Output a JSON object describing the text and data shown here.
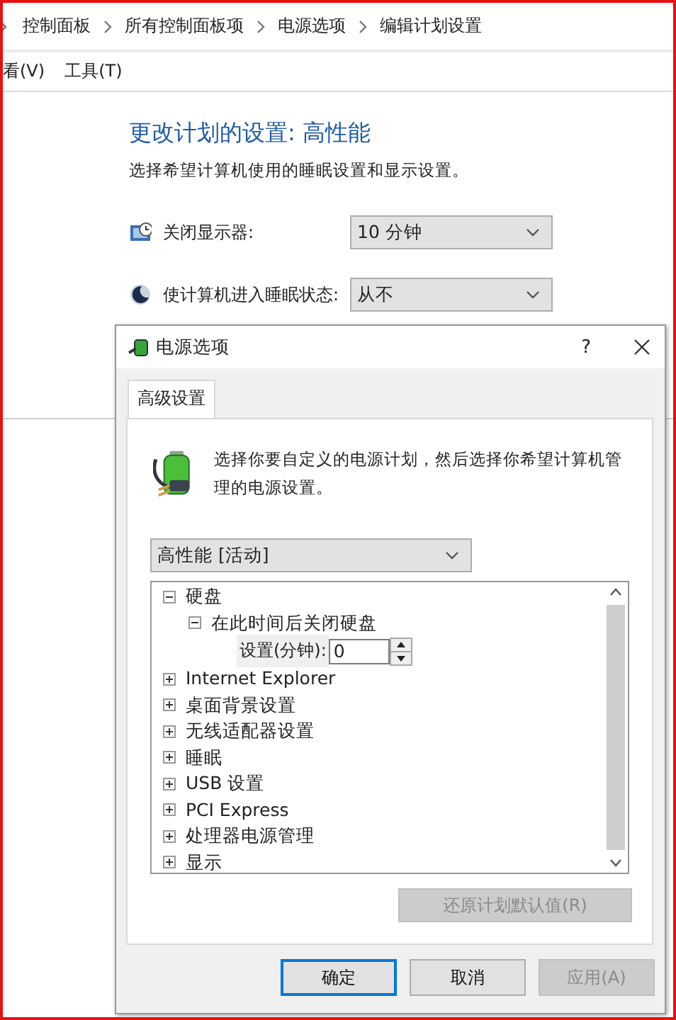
{
  "breadcrumb": [
    "控制面板",
    "所有控制面板项",
    "电源选项",
    "编辑计划设置"
  ],
  "menu": [
    "看(V)",
    "工具(T)"
  ],
  "page": {
    "title": "更改计划的设置: 高性能",
    "subtitle": "选择希望计算机使用的睡眠设置和显示设置。",
    "settings": [
      {
        "kind": "display",
        "label": "关闭显示器:",
        "value": "10 分钟"
      },
      {
        "kind": "sleep",
        "label": "使计算机进入睡眠状态:",
        "value": "从不"
      }
    ]
  },
  "dialog": {
    "title": "电源选项",
    "help": "?",
    "tabs": [
      {
        "label": "高级设置",
        "selected": true
      }
    ],
    "description": "选择你要自定义的电源计划，然后选择你希望计算机管理的电源设置。",
    "plan": "高性能 [活动]",
    "tree": [
      {
        "label": "硬盘",
        "expanded": true,
        "children": [
          {
            "label": "在此时间后关闭硬盘",
            "expanded": true,
            "setting": {
              "label": "设置(分钟):",
              "value": "0"
            }
          }
        ]
      },
      {
        "label": "Internet Explorer",
        "expanded": false
      },
      {
        "label": "桌面背景设置",
        "expanded": false
      },
      {
        "label": "无线适配器设置",
        "expanded": false
      },
      {
        "label": "睡眠",
        "expanded": false
      },
      {
        "label": "USB 设置",
        "expanded": false
      },
      {
        "label": "PCI Express",
        "expanded": false
      },
      {
        "label": "处理器电源管理",
        "expanded": false
      },
      {
        "label": "显示",
        "expanded": false
      }
    ],
    "restore_button": {
      "label": "还原计划默认值(R)",
      "disabled": true
    },
    "buttons": [
      {
        "label": "确定",
        "default": true,
        "disabled": false
      },
      {
        "label": "取消",
        "default": false,
        "disabled": false
      },
      {
        "label": "应用(A)",
        "default": false,
        "disabled": true
      }
    ]
  }
}
